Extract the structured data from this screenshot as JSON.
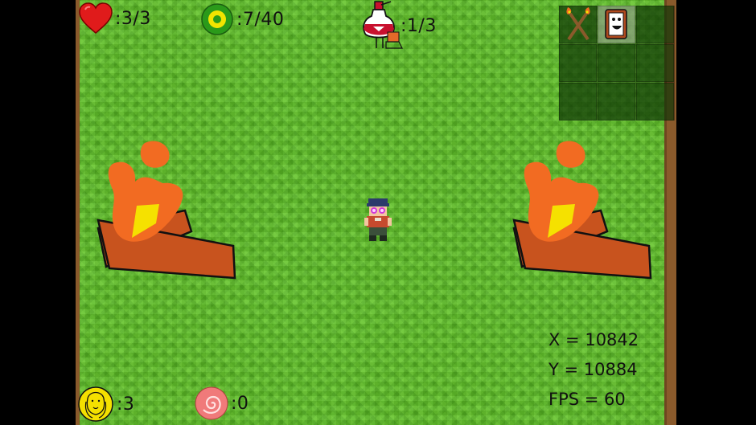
{
  "hud": {
    "health": {
      "icon": "heart-icon",
      "text": ":3/3",
      "color": "#e01b1b"
    },
    "coins": {
      "icon": "ring-coin-icon",
      "text": ":7/40",
      "color": "#2b9a1a"
    },
    "potions": {
      "icon": "potion-bottle-icon",
      "text": ":1/3",
      "color": "#c8102e"
    },
    "portraits": {
      "icon": "yellow-face-icon",
      "text": ":3",
      "color": "#f4e000"
    },
    "spirals": {
      "icon": "pink-spiral-icon",
      "text": ":0",
      "color": "#f07a7a"
    }
  },
  "inventory": {
    "slots": [
      {
        "item": "crossed-torches-icon",
        "selected": false
      },
      {
        "item": "scroll-card-icon",
        "selected": true
      },
      {
        "item": "",
        "selected": false
      },
      {
        "item": "",
        "selected": false
      },
      {
        "item": "",
        "selected": false
      },
      {
        "item": "",
        "selected": false
      },
      {
        "item": "",
        "selected": false
      },
      {
        "item": "",
        "selected": false
      },
      {
        "item": "",
        "selected": false
      }
    ]
  },
  "debug": {
    "x_text": "X = 10842",
    "y_text": "Y = 10884",
    "fps_text": "FPS = 60"
  },
  "world": {
    "ground_color": "#62c12a",
    "border_color": "#8a5a2b",
    "fire_color": "#f26b22",
    "flame_core_color": "#f5e100",
    "log_color": "#c8531e"
  }
}
